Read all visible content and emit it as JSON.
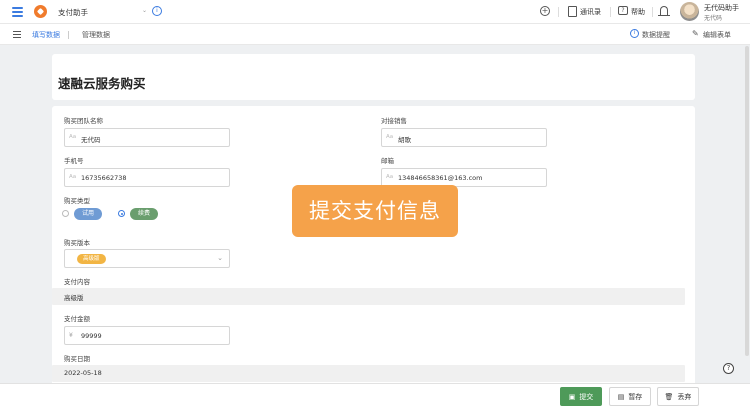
{
  "header": {
    "app_name": "支付助手",
    "contacts": "通讯录",
    "help": "帮助",
    "user_name": "无代码助手",
    "user_org": "无代码"
  },
  "subnav": {
    "fill_data": "填写数据",
    "manage_data": "管理数据",
    "bind_data": "数据提醒",
    "edit_form": "编辑表单"
  },
  "form": {
    "title": "速融云服务购买",
    "team_name": {
      "label": "购买团队名称",
      "value": "无代码"
    },
    "sales": {
      "label": "对接销售",
      "value": "胡歌"
    },
    "phone": {
      "label": "手机号",
      "value": "16735662738"
    },
    "email": {
      "label": "邮箱",
      "value": "134846658361@163.com"
    },
    "purchase_type": {
      "label": "购买类型",
      "options": [
        {
          "label": "试用",
          "color": "#6f9bd4",
          "selected": false
        },
        {
          "label": "续费",
          "color": "#6a9e6e",
          "selected": true
        }
      ]
    },
    "version": {
      "label": "购买版本",
      "value": "高级版"
    },
    "pay_content": {
      "label": "支付内容",
      "value": "高级版"
    },
    "amount": {
      "label": "支付金额",
      "prefix": "¥",
      "value": "99999"
    },
    "date": {
      "label": "购买日期",
      "value": "2022-05-18"
    }
  },
  "overlay": {
    "text": "提交支付信息"
  },
  "actions": {
    "submit": "提交",
    "save_draft": "暂存",
    "discard": "丢弃"
  },
  "colors": {
    "accent": "#3b7be0",
    "logo": "#f07b2c",
    "submit": "#4e9a59",
    "overlay": "#f5a24a",
    "version_tag": "#f2b544"
  }
}
